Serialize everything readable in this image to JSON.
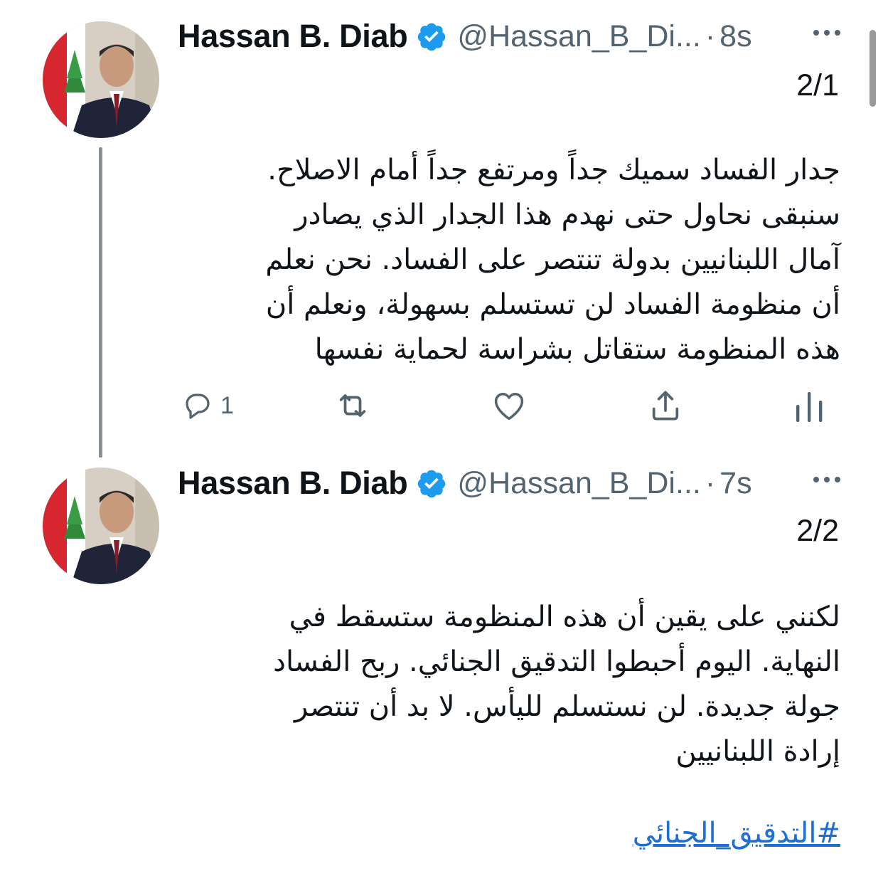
{
  "tweets": [
    {
      "author_name": "Hassan B. Diab",
      "handle": "@Hassan_B_Di...",
      "separator": "·",
      "time": "8s",
      "page_count": "2/1",
      "body_lines": [
        "جدار الفساد سميك جداً ومرتفع جداً أمام الاصلاح.",
        "سنبقى نحاول حتى نهدم هذا الجدار الذي يصادر",
        "آمال اللبنانيين بدولة تنتصر على الفساد. نحن نعلم",
        "أن منظومة الفساد لن تستسلم بسهولة، ونعلم أن",
        "هذه المنظومة ستقاتل بشراسة لحماية نفسها"
      ],
      "reply_count": "1",
      "icons": {
        "reply": "speech-bubble-icon",
        "retweet": "retweet-arrows-icon",
        "like": "heart-icon",
        "share": "share-upload-icon",
        "analytics": "bar-chart-icon",
        "verified": "verified-badge-icon",
        "more": "more-dots-icon"
      }
    },
    {
      "author_name": "Hassan B. Diab",
      "handle": "@Hassan_B_Di...",
      "separator": "·",
      "time": "7s",
      "page_count": "2/2",
      "body_lines": [
        "لكنني على يقين أن هذه المنظومة ستسقط في",
        "النهاية. اليوم أحبطوا التدقيق الجنائي. ربح الفساد",
        "جولة جديدة. لن نستسلم لليأس. لا بد أن تنتصر",
        "إرادة اللبنانيين"
      ],
      "hashtag": "#التدقيق_الجنائي"
    }
  ],
  "colors": {
    "text_primary": "#0f1419",
    "text_secondary": "#536471",
    "verified_blue": "#1d9bf0",
    "link_blue": "#1d6fd6",
    "thread_line": "#8a8f94"
  }
}
